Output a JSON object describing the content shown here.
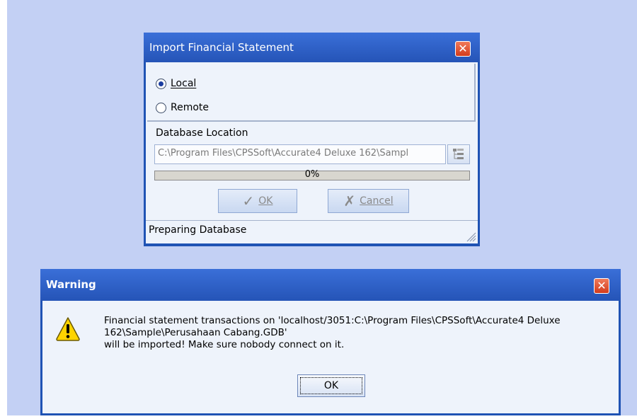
{
  "import_dialog": {
    "title": "Import Financial Statement",
    "radio_local_label": "Local",
    "radio_remote_label": "Remote",
    "selected": "Local",
    "db_location_label": "Database Location",
    "db_path_value": "C:\\Program Files\\CPSSoft\\Accurate4 Deluxe 162\\Sampl",
    "progress_percent": 0,
    "progress_text": "0%",
    "ok_label": "OK",
    "cancel_label": "Cancel",
    "status_text": "Preparing Database"
  },
  "warning_dialog": {
    "title": "Warning",
    "message_line1": "Financial statement transactions on 'localhost/3051:C:\\Program Files\\CPSSoft\\Accurate4 Deluxe",
    "message_line2": "162\\Sample\\Perusahaan Cabang.GDB'",
    "message_line3": "will be imported! Make sure nobody connect on it.",
    "ok_label": "OK"
  },
  "icons": {
    "close": "close-icon",
    "browse": "folder-tree-icon",
    "ok_glyph": "check-icon",
    "cancel_glyph": "x-icon",
    "warning": "warning-icon",
    "grip": "resize-grip-icon"
  },
  "colors": {
    "titlebar": "#2554b7",
    "desktop": "#c3d0f4",
    "dialog_body": "#eef3fb",
    "close_button": "#d33b1c"
  }
}
